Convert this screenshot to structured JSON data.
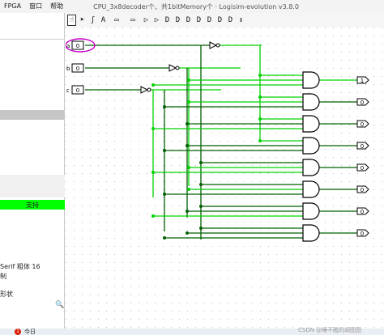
{
  "menus": [
    "FPGA",
    "窗口",
    "帮助"
  ],
  "window_title": "CPU_3x8decoder个、共1bitMemory个 · Logisim-evolution v3.8.0",
  "toolbar": {
    "icons": [
      "poke-tool-icon",
      "select-tool-icon",
      "wiring-tool-icon",
      "text-tool-icon",
      "input-pin-icon",
      "output-pin-icon",
      "not-gate-icon",
      "buffer-icon",
      "and-gate-icon",
      "or-gate-icon",
      "nand-gate-icon",
      "nor-gate-icon",
      "xor-gate-icon",
      "xnor-gate-icon",
      "odd-parity-icon",
      "tunnel-icon"
    ],
    "glyphs": [
      "☝",
      "➤",
      "ʃ",
      "A",
      "▭",
      "▭",
      "▷",
      "▷",
      "D",
      "D",
      "D",
      "D",
      "D",
      "D",
      "D",
      "↕"
    ]
  },
  "left_panel": {
    "highlight_label": "支持",
    "font_label": "Serif 粗体 16",
    "line2": "制",
    "line3": "形状"
  },
  "circuit": {
    "inputs": [
      {
        "label": "a",
        "value": "0"
      },
      {
        "label": "b",
        "value": "0"
      },
      {
        "label": "c",
        "value": "0"
      }
    ],
    "outputs": [
      "1",
      "0",
      "0",
      "0",
      "0",
      "0",
      "0",
      "0"
    ],
    "colors": {
      "wire_high": "#00d200",
      "wire_low": "#005f00",
      "gate": "#000000",
      "highlight": "#cc00cc"
    }
  },
  "taskbar": {
    "badge": "1",
    "label": "今日"
  },
  "watermark": "CSDN @睡不醒的胡图图"
}
